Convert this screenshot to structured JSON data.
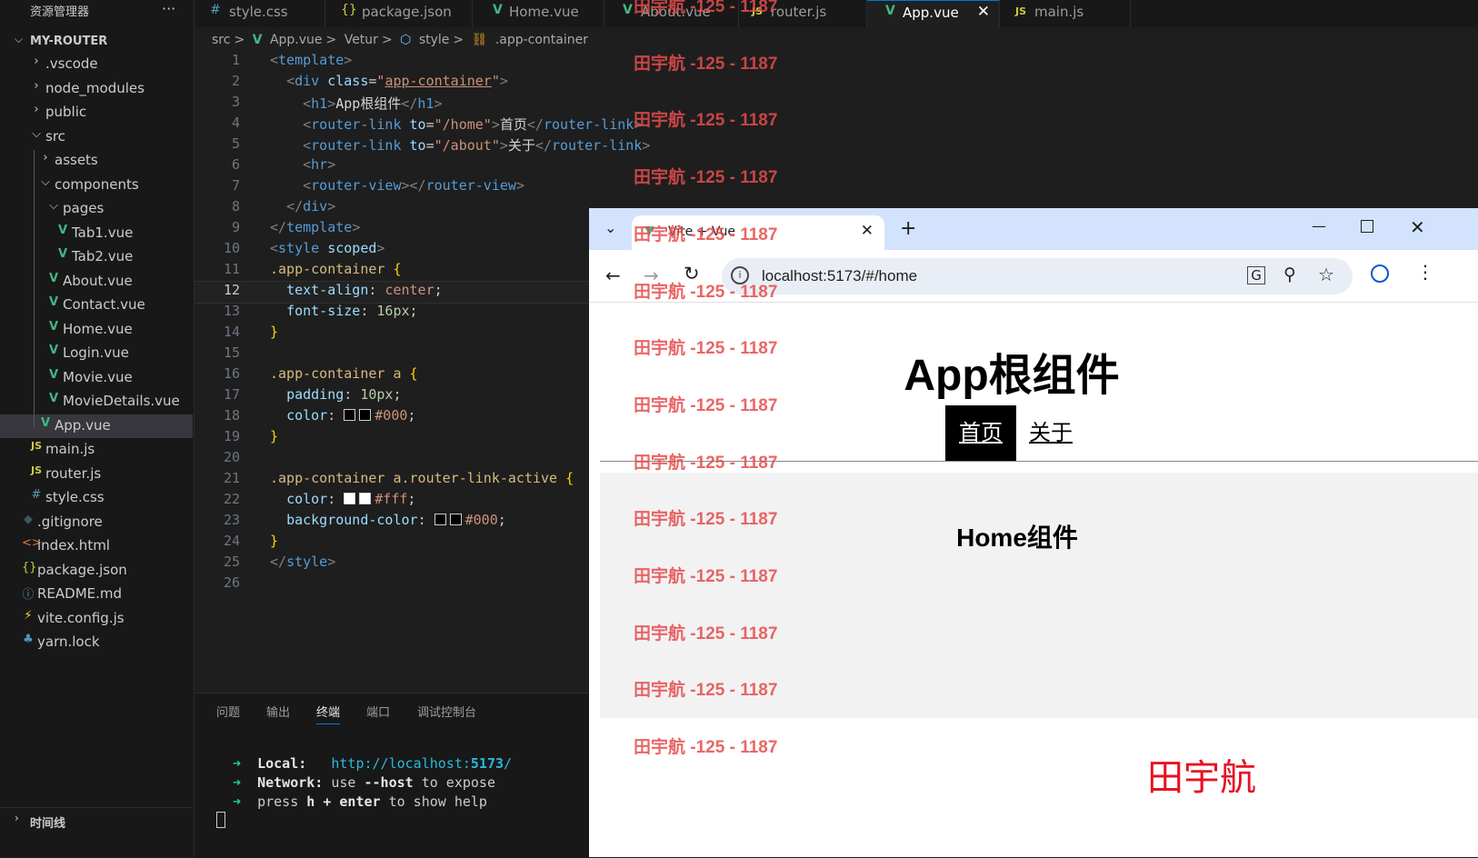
{
  "explorer": {
    "title": "资源管理器",
    "more": "···",
    "root": "MY-ROUTER",
    "items": [
      {
        "label": ".vscode",
        "icon": "chevron-right-icon"
      },
      {
        "label": "node_modules",
        "icon": "chevron-right-icon"
      },
      {
        "label": "public",
        "icon": "chevron-right-icon"
      },
      {
        "label": "src",
        "icon": "chevron-down-icon"
      },
      {
        "label": "assets",
        "icon": "chevron-right-icon"
      },
      {
        "label": "components",
        "icon": "chevron-down-icon"
      },
      {
        "label": "pages",
        "icon": "chevron-down-icon"
      },
      {
        "label": "Tab1.vue",
        "icon": "vue-icon"
      },
      {
        "label": "Tab2.vue",
        "icon": "vue-icon"
      },
      {
        "label": "About.vue",
        "icon": "vue-icon"
      },
      {
        "label": "Contact.vue",
        "icon": "vue-icon"
      },
      {
        "label": "Home.vue",
        "icon": "vue-icon"
      },
      {
        "label": "Login.vue",
        "icon": "vue-icon"
      },
      {
        "label": "Movie.vue",
        "icon": "vue-icon"
      },
      {
        "label": "MovieDetails.vue",
        "icon": "vue-icon"
      },
      {
        "label": "App.vue",
        "icon": "vue-icon"
      },
      {
        "label": "main.js",
        "icon": "js-icon"
      },
      {
        "label": "router.js",
        "icon": "js-icon"
      },
      {
        "label": "style.css",
        "icon": "css-icon"
      },
      {
        "label": ".gitignore",
        "icon": "git-icon"
      },
      {
        "label": "index.html",
        "icon": "html-icon"
      },
      {
        "label": "package.json",
        "icon": "json-icon"
      },
      {
        "label": "README.md",
        "icon": "info-icon"
      },
      {
        "label": "vite.config.js",
        "icon": "vite-icon"
      },
      {
        "label": "yarn.lock",
        "icon": "yarn-icon"
      }
    ],
    "timeline": "时间线"
  },
  "editor_tabs": [
    {
      "label": "style.css",
      "icon": "#"
    },
    {
      "label": "package.json",
      "icon": "{}"
    },
    {
      "label": "Home.vue",
      "icon": "V"
    },
    {
      "label": "About.vue",
      "icon": "V"
    },
    {
      "label": "router.js",
      "icon": "JS"
    },
    {
      "label": "App.vue",
      "icon": "V",
      "active": true
    },
    {
      "label": "main.js",
      "icon": "JS"
    }
  ],
  "breadcrumb": [
    "src",
    ">",
    "App.vue",
    ">",
    "Vetur",
    ">",
    "style",
    ">",
    ".app-container"
  ],
  "code_lines": [
    "1",
    "2",
    "3",
    "4",
    "5",
    "6",
    "7",
    "8",
    "9",
    "10",
    "11",
    "12",
    "13",
    "14",
    "15",
    "16",
    "17",
    "18",
    "19",
    "20",
    "21",
    "22",
    "23",
    "24",
    "25",
    "26"
  ],
  "current_line": "12",
  "panel": {
    "tabs": [
      "问题",
      "输出",
      "终端",
      "端口",
      "调试控制台"
    ],
    "active_tab": "终端",
    "local_label": "Local:",
    "local_url_prefix": "http://localhost:",
    "local_port": "5173",
    "local_url_suffix": "/",
    "network_label": "Network:",
    "network_use": "use",
    "network_flag": "--host",
    "network_rest": "to expose",
    "help_press": "press",
    "help_keys": "h + enter",
    "help_rest": "to show help"
  },
  "browser": {
    "tab_title": "Vite + Vue",
    "url": "localhost:5173/#/home",
    "h1": "App根组件",
    "nav_home": "首页",
    "nav_about": "关于",
    "home_text": "Home组件",
    "signature": "田宇航"
  },
  "watermark": "田宇航 -125 - 1187",
  "colors": {
    "accent": "#0078d4",
    "vue_green": "#41b883",
    "watermark_red": "#e74c4c"
  }
}
